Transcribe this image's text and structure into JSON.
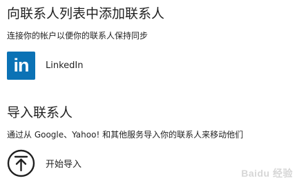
{
  "add_section": {
    "title": "向联系人列表中添加联系人",
    "description": "连接你的帐户以便你的联系人保持同步",
    "linkedin": {
      "icon": "linkedin-icon",
      "icon_text": "in",
      "label": "LinkedIn",
      "brand_color": "#0b72b5"
    }
  },
  "import_section": {
    "title": "导入联系人",
    "description": "通过从 Google、Yahoo! 和其他服务导入你的联系人来移动他们",
    "start": {
      "icon": "upload-arrow-circle-icon",
      "label": "开始导入"
    }
  },
  "watermark": "Baidu 经验"
}
